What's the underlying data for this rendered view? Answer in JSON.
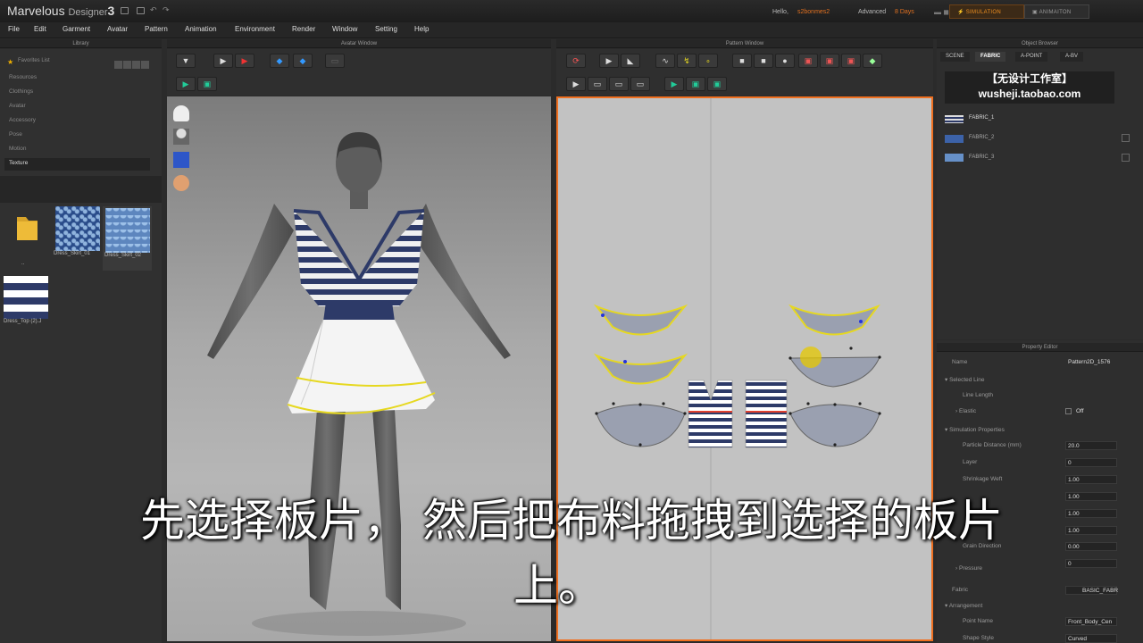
{
  "app": {
    "name": "Marvelous",
    "edition": "Designer",
    "version": "3"
  },
  "account": {
    "hello": "Hello,",
    "user": "s2bonmes2",
    "mode": "Advanced",
    "days": "8 Days"
  },
  "modes": {
    "simulation": "SIMULATION",
    "animation": "ANIMAITON"
  },
  "menu": [
    "File",
    "Edit",
    "Garment",
    "Avatar",
    "Pattern",
    "Animation",
    "Environment",
    "Render",
    "Window",
    "Setting",
    "Help"
  ],
  "panels": {
    "library": "Library",
    "avatar": "Avatar Window",
    "pattern": "Pattern Window",
    "object_browser": "Object Browser",
    "property_editor": "Property Editor"
  },
  "library": {
    "favorites": "Favorites List",
    "items": [
      "Resources",
      "Clothings",
      "Avatar",
      "Accessory",
      "Pose",
      "Motion",
      "Texture"
    ],
    "files": [
      {
        "name": ".."
      },
      {
        "name": "Dress_Skirt_01"
      },
      {
        "name": "Dress_Skirt_02"
      },
      {
        "name": "Dress_Top (2).J"
      }
    ]
  },
  "object_browser": {
    "tabs": [
      "SCENE",
      "FABRIC",
      "A-POINT",
      "A-BV"
    ],
    "watermark": [
      "【无设计工作室】",
      "wusheji.taobao.com"
    ],
    "fabrics": [
      "FABRIC_1",
      "FABRIC_2",
      "FABRIC_3"
    ]
  },
  "property_editor": {
    "name_label": "Name",
    "name_value": "Pattern2D_1576",
    "selected_line": "Selected Line",
    "line_length": "Line Length",
    "elastic": "Elastic",
    "elastic_value": "Off",
    "sim_props": "Simulation Properties",
    "particle_distance": "Particle Distance (mm)",
    "particle_distance_value": "20.0",
    "layer": "Layer",
    "layer_value": "0",
    "shrinkage_weft": "Shrinkage Weft",
    "shrinkage_weft_value": "1.00",
    "v4": "1.00",
    "v5": "1.00",
    "v6": "1.00",
    "grain_direction": "Grain Direction",
    "grain_direction_value": "0.00",
    "pressure": "Pressure",
    "pressure_value": "0",
    "fabric": "Fabric",
    "fabric_value": "BASIC_FABR",
    "arrangement": "Arrangement",
    "point_name": "Point Name",
    "point_name_value": "Front_Body_Cen",
    "shape_style": "Shape Style",
    "shape_style_value": "Curved"
  },
  "subtitle": {
    "line1": "先选择板片， 然后把布料拖拽到选择的板片",
    "line2": "上。"
  },
  "colors": {
    "accent": "#f07020",
    "highlight": "#e6d820",
    "stripe": "#2d3a68"
  }
}
